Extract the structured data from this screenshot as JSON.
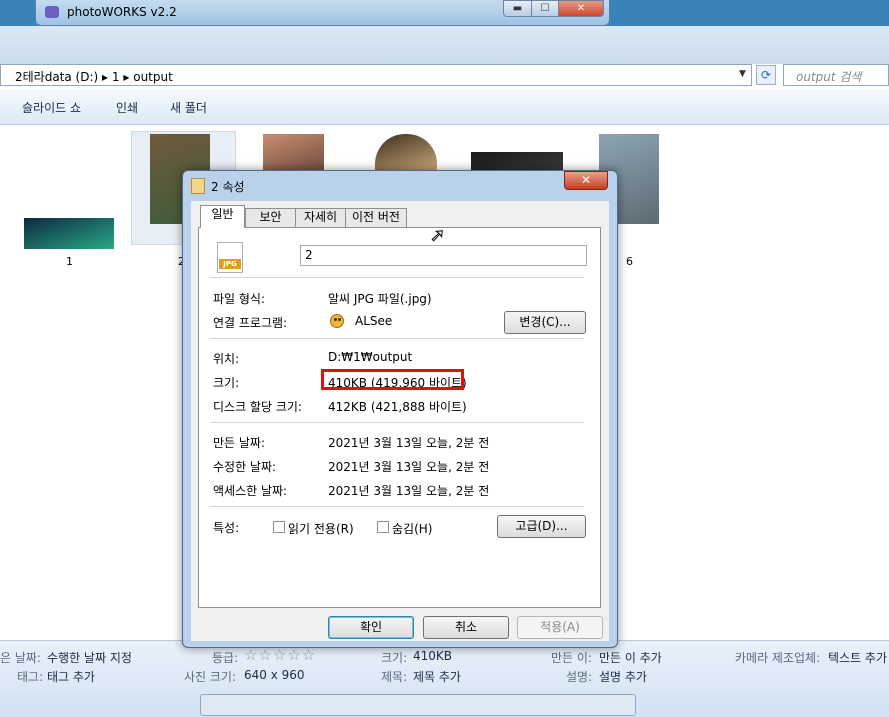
{
  "photoworks": {
    "title": "photoWORKS v2.2",
    "min_glyph": "▬",
    "max_glyph": "☐",
    "close_glyph": "✕"
  },
  "explorer": {
    "address": {
      "path": [
        "2테라data (D:)",
        "1",
        "output"
      ],
      "separator": "▸",
      "dropdown_glyph": "▼"
    },
    "refresh_glyph": "⟳",
    "search_placeholder": "output 검색",
    "toolbar": {
      "slideshow": "슬라이드 쇼",
      "print": "인쇄",
      "new_folder": "새 폴더"
    },
    "thumbnails": [
      {
        "label": "1",
        "colors": [
          "#0b2a3e",
          "#2aa887"
        ]
      },
      {
        "label": "2",
        "colors": [
          "#6f5a3a",
          "#3e5c3b"
        ]
      },
      {
        "label": "",
        "colors": [
          "#c88e72",
          "#6c4a3c"
        ]
      },
      {
        "label": "",
        "colors": [
          "#3f2f21",
          "#cfae7a"
        ]
      },
      {
        "label": "",
        "colors": [
          "#1a1a1a",
          "#3a3a3a"
        ]
      },
      {
        "label": "6",
        "colors": [
          "#8da4b4",
          "#5d6b72"
        ]
      }
    ],
    "details": {
      "date_taken_label": "은 날짜:",
      "date_taken_value": "수행한 날짜 지정",
      "rating_label": "등급:",
      "rating_stars": "☆☆☆☆☆",
      "size_label": "크기:",
      "size_value": "410KB",
      "author_label": "만든 이:",
      "author_value": "만든 이 추가",
      "camera_label": "카메라 제조업체:",
      "camera_value": "텍스트 추가",
      "tags_label": "태그:",
      "tags_value": "태그 추가",
      "dimensions_label": "사진 크기:",
      "dimensions_value": "640 x 960",
      "title_label": "제목:",
      "title_value": "제목 추가",
      "desc_label": "설명:",
      "desc_value": "설명 추가"
    }
  },
  "dialog": {
    "title": "2 속성",
    "close_glyph": "✕",
    "tabs": [
      "일반",
      "보안",
      "자세히",
      "이전 버전"
    ],
    "file_icon_text": "JPG",
    "filename": "2",
    "rows": {
      "type_label": "파일 형식:",
      "type_value": "알씨 JPG 파일(.jpg)",
      "opens_label": "연결 프로그램:",
      "opens_value": "ALSee",
      "change_button": "변경(C)...",
      "location_label": "위치:",
      "location_value": "D:₩1₩output",
      "size_label": "크기:",
      "size_value": "410KB (419,960 바이트)",
      "disk_label": "디스크 할당 크기:",
      "disk_value": "412KB (421,888 바이트)",
      "created_label": "만든 날짜:",
      "created_value": "2021년 3월 13일 오늘, 2분 전",
      "modified_label": "수정한 날짜:",
      "modified_value": "2021년 3월 13일 오늘, 2분 전",
      "accessed_label": "액세스한 날짜:",
      "accessed_value": "2021년 3월 13일 오늘, 2분 전",
      "attributes_label": "특성:",
      "readonly_label": "읽기 전용(R)",
      "hidden_label": "숨김(H)",
      "advanced_button": "고급(D)..."
    },
    "buttons": {
      "ok": "확인",
      "cancel": "취소",
      "apply": "적용(A)"
    }
  }
}
